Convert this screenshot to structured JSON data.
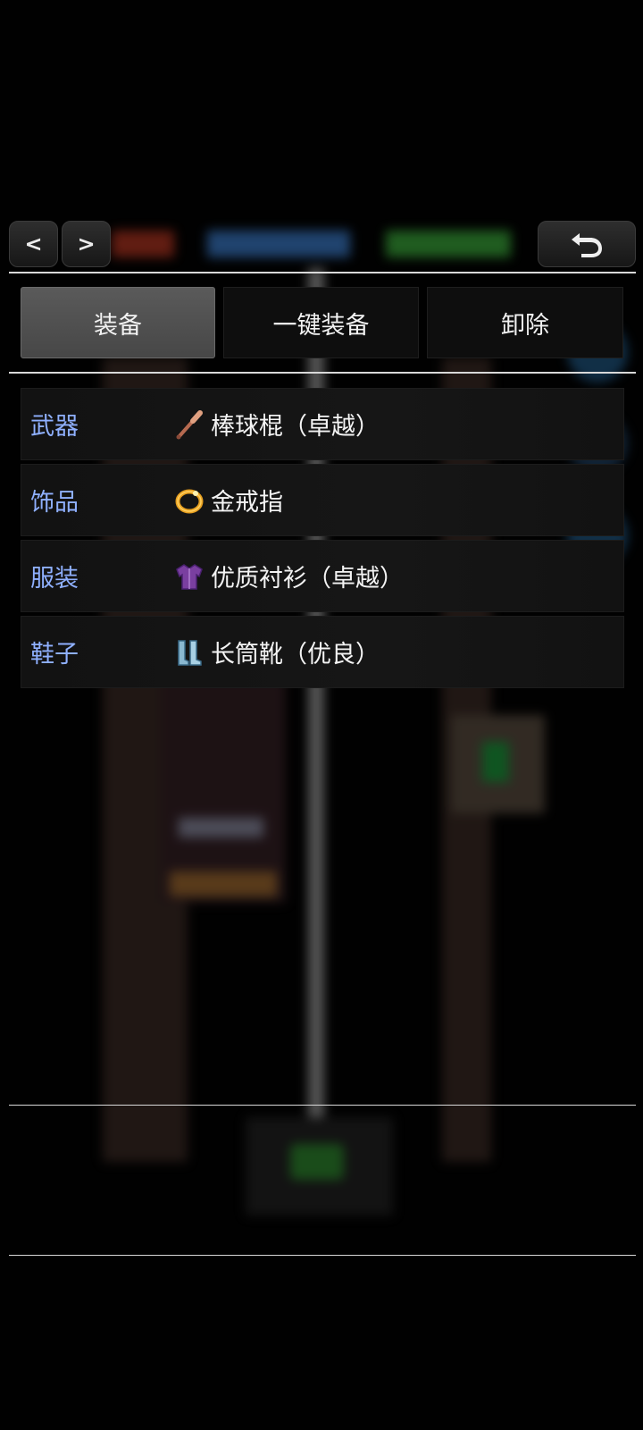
{
  "nav": {
    "prev_label": "<",
    "next_label": ">",
    "back_icon": "undo-arrow-icon"
  },
  "tabs": [
    {
      "label": "装备",
      "active": true
    },
    {
      "label": "一键装备",
      "active": false
    },
    {
      "label": "卸除",
      "active": false
    }
  ],
  "slots": [
    {
      "type": "武器",
      "item": "棒球棍（卓越）",
      "icon": "baseball-bat-icon"
    },
    {
      "type": "饰品",
      "item": "金戒指",
      "icon": "gold-ring-icon"
    },
    {
      "type": "服装",
      "item": "优质衬衫（卓越）",
      "icon": "shirt-icon"
    },
    {
      "type": "鞋子",
      "item": "长筒靴（优良）",
      "icon": "boots-icon"
    }
  ],
  "colors": {
    "slot_label": "#8fb0ff",
    "active_tab": "#525252",
    "background": "#000000"
  }
}
